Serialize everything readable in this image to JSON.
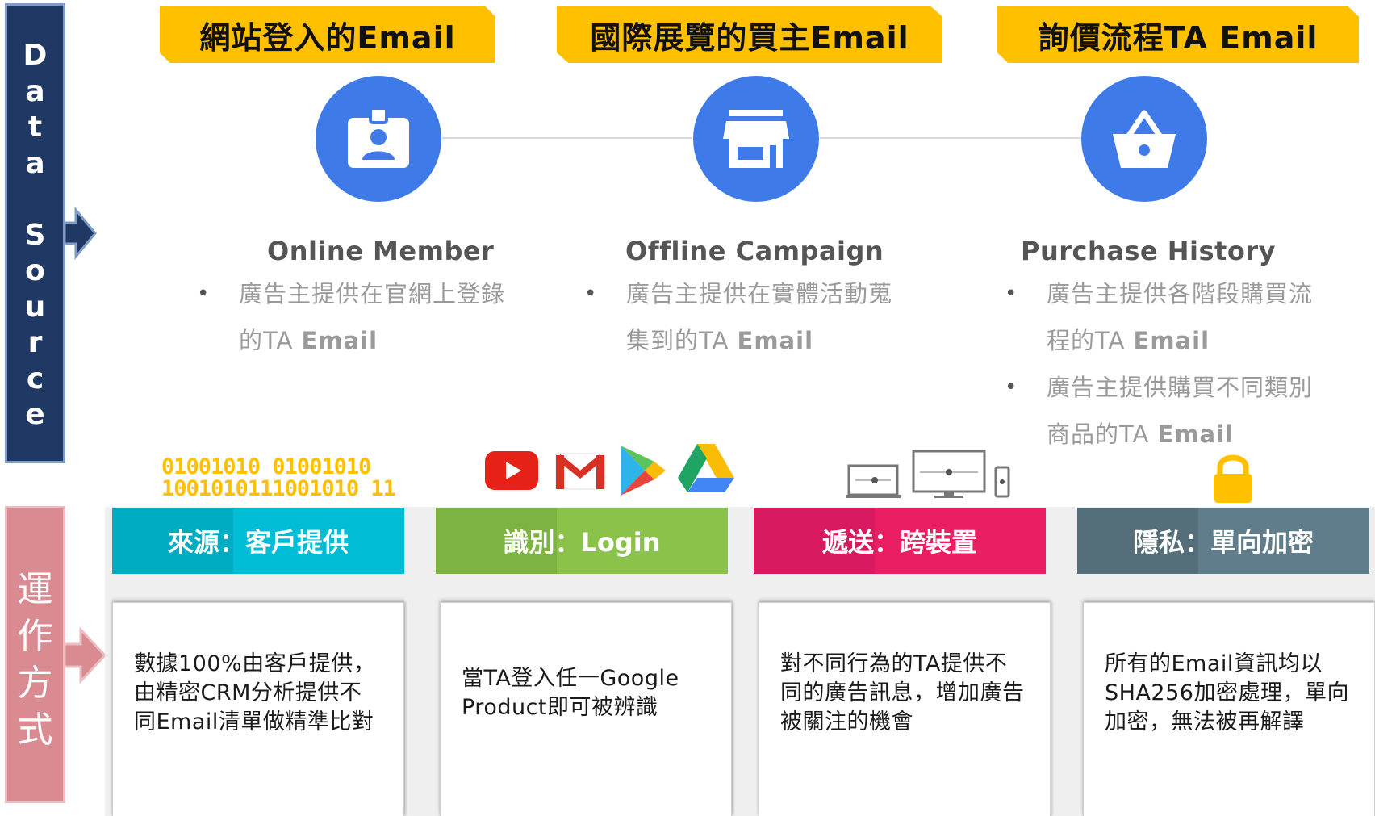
{
  "left_labels": {
    "data_source": [
      "D",
      "a",
      "t",
      "a",
      " ",
      "S",
      "o",
      "u",
      "r",
      "c",
      "e"
    ],
    "operation": [
      "運",
      "作",
      "方",
      "式"
    ]
  },
  "banners": [
    "網站登入的Email",
    "國際展覽的買主Email",
    "詢價流程TA Email"
  ],
  "sources": [
    {
      "icon": "id-badge-icon",
      "title": "Online Member",
      "bullets": [
        {
          "text": "廣告主提供在官網上登錄",
          "text2": "的TA ",
          "email": "Email"
        }
      ]
    },
    {
      "icon": "storefront-icon",
      "title": "Offline Campaign",
      "bullets": [
        {
          "text": "廣告主提供在實體活動蒐",
          "text2": "集到的TA ",
          "email": "Email"
        }
      ]
    },
    {
      "icon": "shopping-basket-icon",
      "title": "Purchase History",
      "bullets": [
        {
          "text": "廣告主提供各階段購買流",
          "text2": "程的TA ",
          "email": "Email"
        },
        {
          "text": "廣告主提供購買不同類別",
          "text2": "商品的TA ",
          "email": "Email"
        }
      ]
    }
  ],
  "binary": [
    "01001010 01001010",
    "1001010111001010 11"
  ],
  "decorations": [
    "youtube-icon",
    "gmail-icon",
    "google-play-icon",
    "google-drive-icon",
    "devices-icon",
    "lock-icon"
  ],
  "categories": [
    {
      "label": "來源：客戶提供",
      "color": "#00bcd4"
    },
    {
      "label": "識別：Login",
      "color": "#8bc34a"
    },
    {
      "label": "遞送：跨裝置",
      "color": "#e91e63"
    },
    {
      "label": "隱私：單向加密",
      "color": "#607d8b"
    }
  ],
  "cards": [
    "數據100%由客戶提供，由精密CRM分析提供不同Email清單做精準比對",
    "當TA登入任一Google Product即可被辨識",
    "對不同行為的TA提供不同的廣告訊息，增加廣告被關注的機會",
    "所有的Email資訊均以SHA256加密處理，單向加密，無法被再解譯"
  ],
  "colors": {
    "navy": "#1f3864",
    "pink": "#d98b91",
    "banner": "#ffc000",
    "icon_blue": "#3f7be8"
  }
}
